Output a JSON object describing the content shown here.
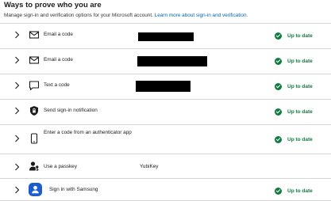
{
  "header": {
    "title": "Ways to prove who you are",
    "subtitle": "Manage sign-in and verification options for your Microsoft account.",
    "learn_more": "Learn more about sign-in and verification."
  },
  "methods": [
    {
      "label": "Email a code",
      "icon": "envelope-icon",
      "value": "",
      "redacted": true,
      "status": "Up to date"
    },
    {
      "label": "Email a code",
      "icon": "envelope-icon",
      "value": "",
      "redacted": true,
      "status": "Up to date"
    },
    {
      "label": "Text a code",
      "icon": "chat-bubble-icon",
      "value": "",
      "redacted": true,
      "status": "Up to date"
    },
    {
      "label": "Send sign-in notification",
      "icon": "shield-lock-icon",
      "value": "",
      "redacted": false,
      "status": "Up to date"
    },
    {
      "label": "Enter a code from an authenticator app",
      "icon": "phone-icon",
      "value": "",
      "redacted": false,
      "status": "Up to date"
    },
    {
      "label": "Use a passkey",
      "icon": "person-key-icon",
      "value": "YubiKey",
      "redacted": false,
      "status": ""
    },
    {
      "label": "Sign in with Samsung",
      "icon": "samsung-icon",
      "value": "",
      "redacted": false,
      "status": "Up to date"
    }
  ],
  "colors": {
    "accent": "#0067b8",
    "success": "#107c41",
    "samsung": "#1c5dd0"
  }
}
